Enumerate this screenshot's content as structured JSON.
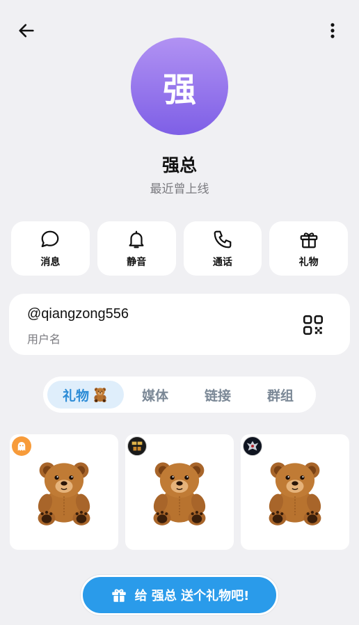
{
  "header": {
    "back_icon": "arrow-left-icon",
    "more_icon": "more-vertical-icon"
  },
  "profile": {
    "avatar_letter": "强",
    "avatar_colors": [
      "#b192f3",
      "#7e5fe6"
    ],
    "name": "强总",
    "status": "最近曾上线"
  },
  "actions": [
    {
      "label": "消息",
      "icon": "message-bubble-icon"
    },
    {
      "label": "静音",
      "icon": "bell-icon"
    },
    {
      "label": "通话",
      "icon": "phone-icon"
    },
    {
      "label": "礼物",
      "icon": "gift-icon"
    }
  ],
  "user": {
    "handle": "@qiangzong556",
    "handle_label": "用户名",
    "qr_icon": "qr-code-icon"
  },
  "tabs": [
    {
      "label": "礼物",
      "active": true,
      "emoji": "teddy-bear"
    },
    {
      "label": "媒体",
      "active": false
    },
    {
      "label": "链接",
      "active": false
    },
    {
      "label": "群组",
      "active": false
    }
  ],
  "gifts": [
    {
      "item": "teddy-bear",
      "badge": "ghost-icon"
    },
    {
      "item": "teddy-bear",
      "badge": "avatar-dark"
    },
    {
      "item": "teddy-bear",
      "badge": "avatar-emblem"
    }
  ],
  "send_button": {
    "label": "给 强总 送个礼物吧!",
    "icon": "gift-icon",
    "color": "#2a9bea"
  },
  "colors": {
    "background": "#f0f0f3",
    "accent": "#2b8bd6",
    "tab_active_bg": "#dfeefb"
  }
}
